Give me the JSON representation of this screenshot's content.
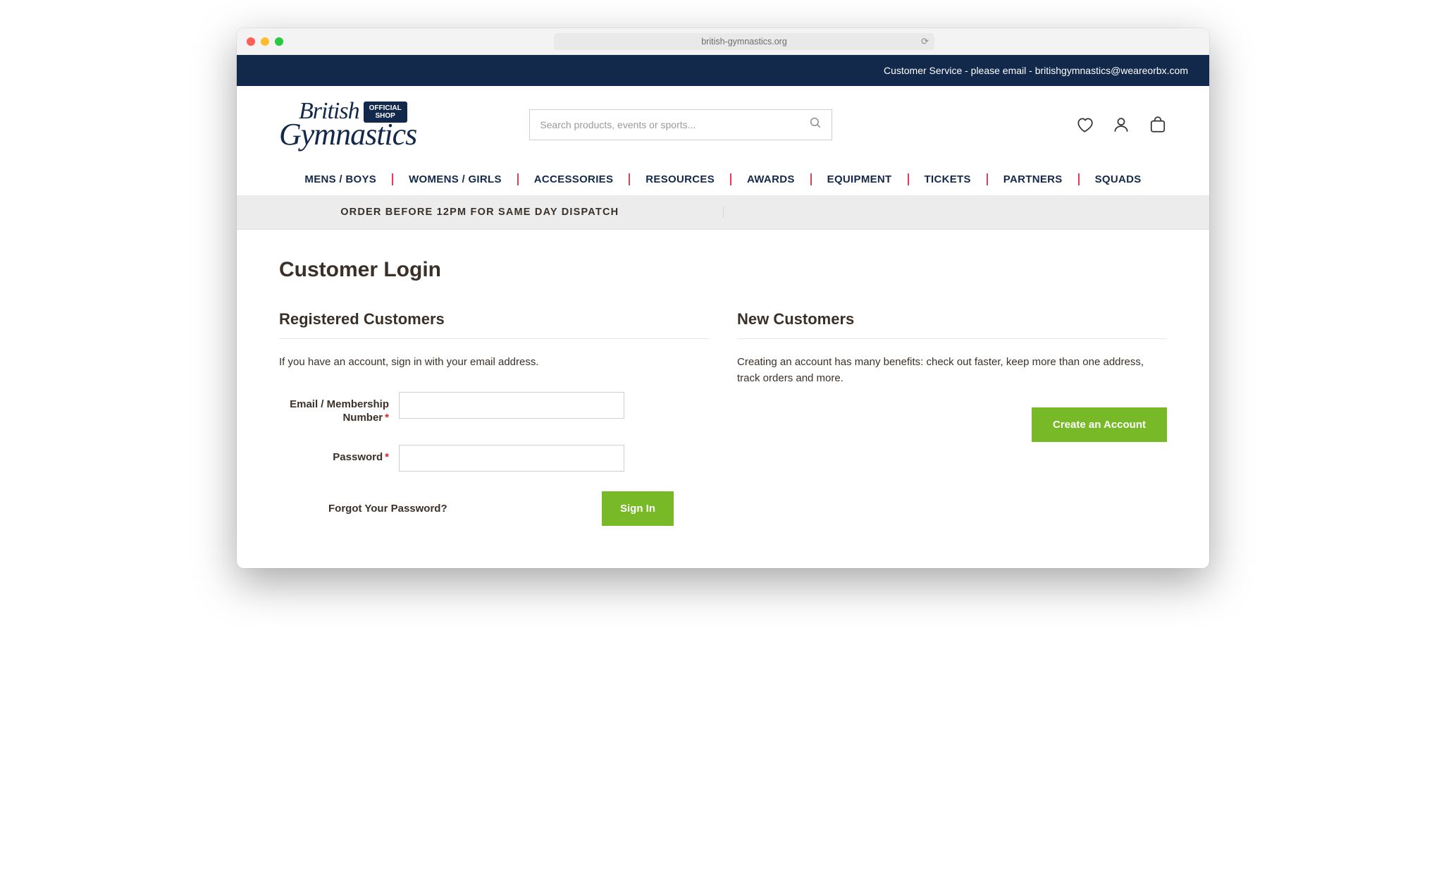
{
  "browser": {
    "url": "british-gymnastics.org"
  },
  "topbar": {
    "text": "Customer Service - please email - britishgymnastics@weareorbx.com"
  },
  "logo": {
    "line1": "British",
    "line2": "Gymnastics",
    "badge_line1": "OFFICIAL",
    "badge_line2": "SHOP"
  },
  "search": {
    "placeholder": "Search products, events or sports..."
  },
  "nav": {
    "items": [
      "MENS / BOYS",
      "WOMENS / GIRLS",
      "ACCESSORIES",
      "RESOURCES",
      "AWARDS",
      "EQUIPMENT",
      "TICKETS",
      "PARTNERS",
      "SQUADS"
    ]
  },
  "banner": {
    "cell1": "ORDER BEFORE 12PM FOR SAME DAY DISPATCH",
    "cell2": ""
  },
  "page": {
    "title": "Customer Login",
    "registered": {
      "heading": "Registered Customers",
      "lead": "If you have an account, sign in with your email address.",
      "email_label": "Email / Membership Number",
      "password_label": "Password",
      "forgot": "Forgot Your Password?",
      "signin": "Sign In"
    },
    "new": {
      "heading": "New Customers",
      "lead": "Creating an account has many benefits: check out faster, keep more than one address, track orders and more.",
      "create": "Create an Account"
    }
  }
}
